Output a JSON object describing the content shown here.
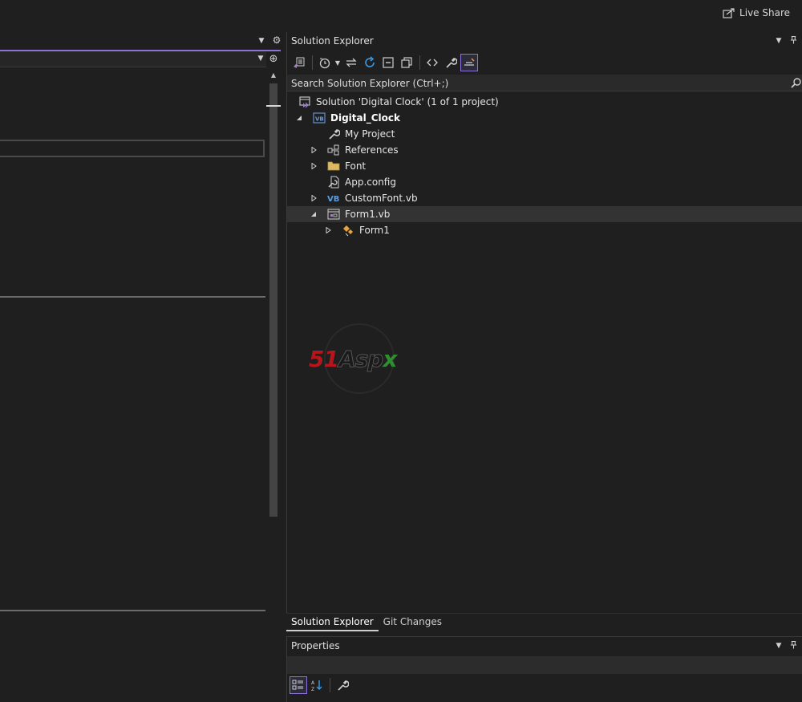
{
  "header": {
    "live_share_label": "Live Share"
  },
  "solution_explorer": {
    "title": "Solution Explorer",
    "search_placeholder": "Search Solution Explorer (Ctrl+;)",
    "tree": [
      {
        "id": "solution",
        "label": "Solution 'Digital Clock' (1 of 1 project)",
        "icon": "solution-icon",
        "level": 0,
        "expander": "none"
      },
      {
        "id": "project",
        "label": "Digital_Clock",
        "icon": "vb-project-icon",
        "level": 1,
        "expander": "expanded",
        "bold": true
      },
      {
        "id": "my-project",
        "label": "My Project",
        "icon": "wrench-icon",
        "level": 2,
        "expander": "none"
      },
      {
        "id": "references",
        "label": "References",
        "icon": "references-icon",
        "level": 2,
        "expander": "collapsed"
      },
      {
        "id": "font",
        "label": "Font",
        "icon": "folder-icon",
        "level": 2,
        "expander": "collapsed"
      },
      {
        "id": "app-config",
        "label": "App.config",
        "icon": "config-icon",
        "level": 2,
        "expander": "none"
      },
      {
        "id": "customfont",
        "label": "CustomFont.vb",
        "icon": "vb-file-icon",
        "level": 2,
        "expander": "collapsed"
      },
      {
        "id": "form1vb",
        "label": "Form1.vb",
        "icon": "form-icon",
        "level": 2,
        "expander": "expanded",
        "selected": true
      },
      {
        "id": "form1",
        "label": "Form1",
        "icon": "class-icon",
        "level": 3,
        "expander": "collapsed"
      }
    ]
  },
  "bottom_tabs": [
    {
      "label": "Solution Explorer",
      "active": true
    },
    {
      "label": "Git Changes",
      "active": false
    }
  ],
  "properties": {
    "title": "Properties"
  },
  "colors": {
    "accent": "#8e73d6",
    "background": "#1f1f1f",
    "selection": "#333333"
  }
}
